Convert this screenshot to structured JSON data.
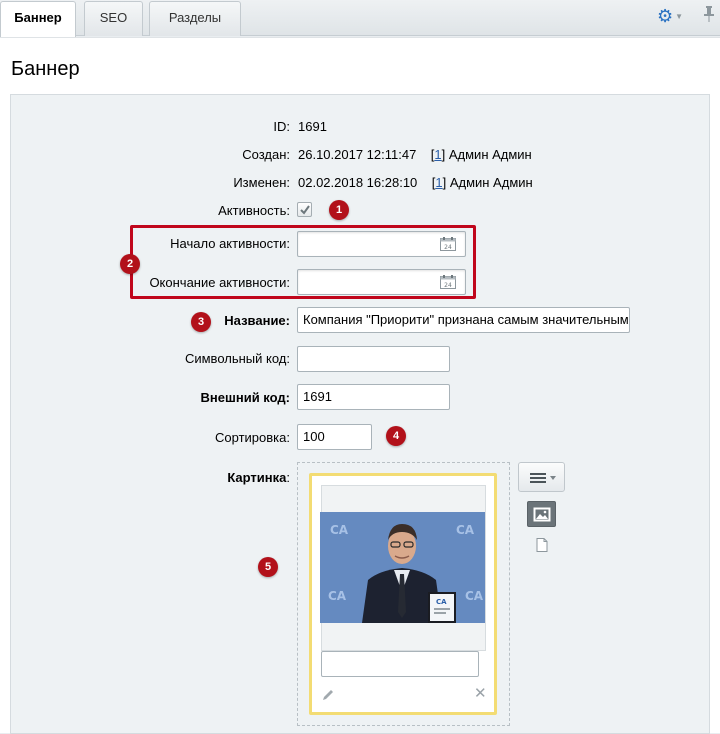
{
  "tabs": [
    {
      "label": "Баннер",
      "active": true
    },
    {
      "label": "SEO",
      "active": false
    },
    {
      "label": "Разделы",
      "active": false
    }
  ],
  "header": {
    "settings_icon": "gear-icon",
    "pin_icon": "pin-icon"
  },
  "page_title": "Баннер",
  "form": {
    "id_label": "ID:",
    "id_value": "1691",
    "created_label": "Создан:",
    "created_value": "26.10.2017 12:11:47",
    "created_user_id": "1",
    "created_user": "Админ Админ",
    "modified_label": "Изменен:",
    "modified_value": "02.02.2018 16:28:10",
    "modified_user_id": "1",
    "modified_user": "Админ Админ",
    "active_label": "Активность:",
    "active_checked": true,
    "active_from_label": "Начало активности:",
    "active_from_value": "",
    "active_to_label": "Окончание активности:",
    "active_to_value": "",
    "name_label": "Название:",
    "name_value": "Компания \"Приорити\" признана самым значительным",
    "code_label": "Символьный код:",
    "code_value": "",
    "xml_id_label": "Внешний код:",
    "xml_id_value": "1691",
    "sort_label": "Сортировка:",
    "sort_value": "100",
    "picture_label": "Картинка",
    "picture_colon": ":",
    "picture_description": ""
  },
  "badges": [
    "1",
    "2",
    "3",
    "4",
    "5"
  ],
  "colors": {
    "highlight_red": "#c0061c",
    "badge_red": "#b2111a",
    "link_blue": "#2a5ea8",
    "card_yellow": "#f3dc73",
    "gear_blue": "#2a72c2"
  }
}
